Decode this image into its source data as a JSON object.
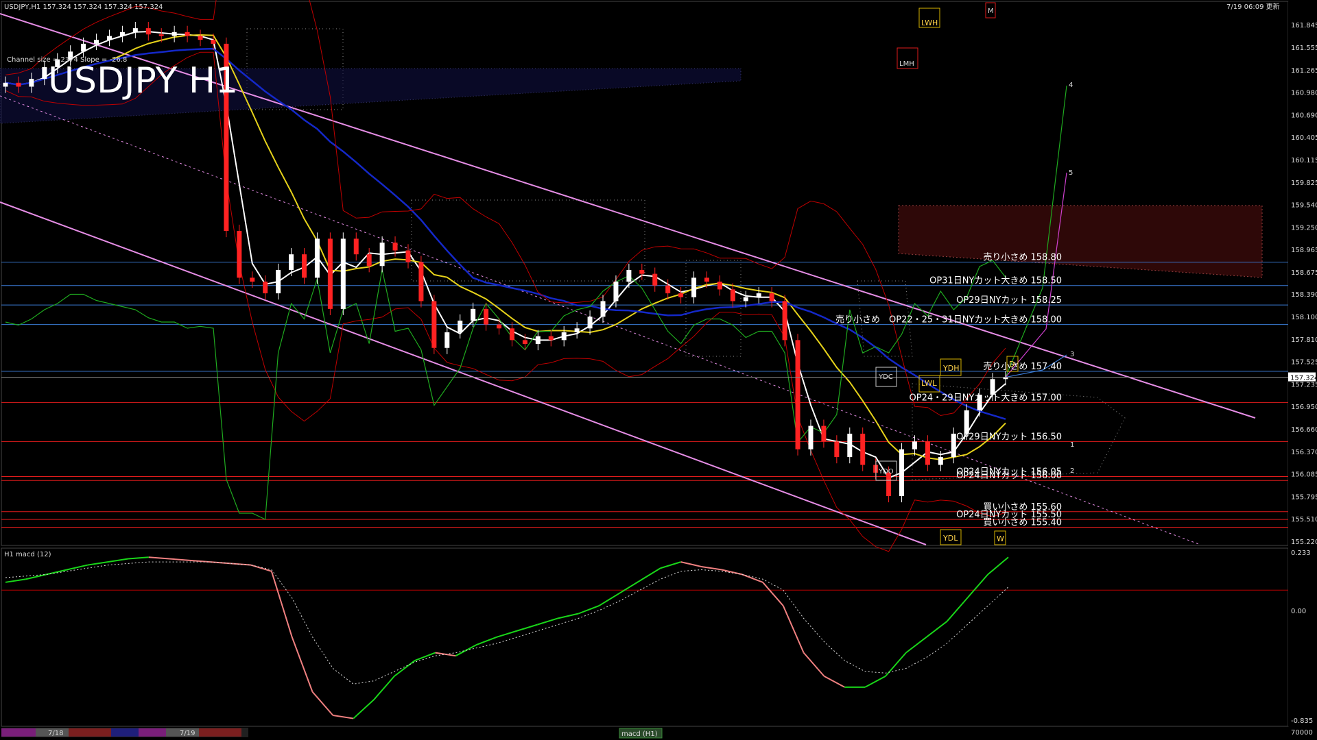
{
  "header": {
    "symbol_line": "USDJPY,H1  157.324 157.324 157.324 157.324",
    "timestamp": "7/19 06:09 更新",
    "channel_info": "Channel size = 2374 Slope = -26.8",
    "watermark": "USDJPY H1",
    "macd_label": "H1  macd (12)"
  },
  "price_axis": {
    "ticks": [
      "161.845",
      "161.555",
      "161.265",
      "160.980",
      "160.690",
      "160.405",
      "160.115",
      "159.825",
      "159.540",
      "159.250",
      "158.965",
      "158.675",
      "158.390",
      "158.100",
      "157.810",
      "157.525",
      "157.235",
      "156.950",
      "156.660",
      "156.370",
      "156.085",
      "155.795",
      "155.510",
      "155.220"
    ],
    "current": "157.324"
  },
  "macd_axis": {
    "ticks": [
      "0.233",
      "0.00",
      "-0.835",
      "70000"
    ]
  },
  "levels": [
    {
      "label": "売り小さめ 158.80",
      "price": 158.8,
      "color": "#3a7bd5"
    },
    {
      "label": "OP31日NYカット大きめ 158.50",
      "price": 158.5,
      "color": "#3a7bd5"
    },
    {
      "label": "OP29日NYカット 158.25",
      "price": 158.25,
      "color": "#3a7bd5"
    },
    {
      "label": "売り小さめ　OP22・25・31日NYカット大きめ 158.00",
      "price": 158.0,
      "color": "#3a7bd5"
    },
    {
      "label": "売り小さめ 157.40",
      "price": 157.4,
      "color": "#3a7bd5"
    },
    {
      "label": "OP24・29日NYカット大きめ 157.00",
      "price": 157.0,
      "color": "#e01b1b"
    },
    {
      "label": "OP29日NYカット 156.50",
      "price": 156.5,
      "color": "#e01b1b"
    },
    {
      "label": "OP24日NYカット 156.05",
      "price": 156.05,
      "color": "#e01b1b"
    },
    {
      "label": "OP24日NYカット 156.00",
      "price": 156.0,
      "color": "#e01b1b"
    },
    {
      "label": "買い小さめ 155.60",
      "price": 155.6,
      "color": "#e01b1b"
    },
    {
      "label": "OP24日NYカット 155.50",
      "price": 155.5,
      "color": "#e01b1b"
    },
    {
      "label": "買い小さめ 155.40",
      "price": 155.4,
      "color": "#e01b1b"
    }
  ],
  "markers": [
    "YDC",
    "YDH",
    "LWL",
    "YDO",
    "YDL",
    "LWH",
    "LMH",
    "M",
    "D",
    "W"
  ],
  "projection_labels": [
    "1",
    "2",
    "3",
    "4",
    "5"
  ],
  "bottom_bar": {
    "dates": [
      "7/18",
      "7/19"
    ],
    "tab": "macd (H1)"
  },
  "chart_data": {
    "type": "candlestick",
    "title": "USDJPY H1",
    "ylim": [
      155.22,
      161.845
    ],
    "close_path": [
      161.1,
      161.05,
      161.15,
      161.3,
      161.4,
      161.5,
      161.6,
      161.65,
      161.7,
      161.75,
      161.8,
      161.72,
      161.7,
      161.75,
      161.7,
      161.65,
      161.6,
      159.2,
      158.6,
      158.55,
      158.4,
      158.7,
      158.9,
      158.6,
      159.1,
      158.2,
      159.1,
      158.9,
      158.75,
      159.05,
      158.95,
      158.8,
      158.3,
      157.7,
      157.9,
      158.05,
      158.2,
      158.0,
      157.95,
      157.8,
      157.75,
      157.85,
      157.8,
      157.9,
      157.95,
      158.1,
      158.3,
      158.55,
      158.7,
      158.65,
      158.5,
      158.4,
      158.35,
      158.6,
      158.55,
      158.45,
      158.3,
      158.35,
      158.4,
      158.3,
      157.8,
      156.4,
      156.7,
      156.5,
      156.3,
      156.6,
      156.2,
      156.1,
      155.8,
      156.4,
      156.5,
      156.2,
      156.3,
      156.6,
      156.9,
      157.1,
      157.3,
      157.324
    ],
    "macd": [
      0.05,
      0.07,
      0.1,
      0.13,
      0.16,
      0.18,
      0.2,
      0.21,
      0.2,
      0.19,
      0.18,
      0.17,
      0.16,
      0.12,
      -0.3,
      -0.65,
      -0.8,
      -0.82,
      -0.7,
      -0.55,
      -0.45,
      -0.4,
      -0.42,
      -0.35,
      -0.3,
      -0.26,
      -0.22,
      -0.18,
      -0.15,
      -0.1,
      -0.02,
      0.06,
      0.14,
      0.18,
      0.15,
      0.13,
      0.1,
      0.05,
      -0.1,
      -0.4,
      -0.55,
      -0.62,
      -0.62,
      -0.55,
      -0.4,
      -0.3,
      -0.2,
      -0.05,
      0.1,
      0.21
    ],
    "signal": [
      0.08,
      0.09,
      0.1,
      0.12,
      0.14,
      0.16,
      0.17,
      0.18,
      0.18,
      0.18,
      0.18,
      0.17,
      0.16,
      0.13,
      -0.05,
      -0.3,
      -0.5,
      -0.6,
      -0.58,
      -0.52,
      -0.46,
      -0.42,
      -0.4,
      -0.37,
      -0.34,
      -0.3,
      -0.26,
      -0.22,
      -0.18,
      -0.13,
      -0.07,
      0.0,
      0.07,
      0.12,
      0.13,
      0.12,
      0.1,
      0.07,
      0.0,
      -0.18,
      -0.33,
      -0.45,
      -0.52,
      -0.53,
      -0.5,
      -0.43,
      -0.34,
      -0.22,
      -0.1,
      0.02
    ],
    "macd_ylim": [
      -0.835,
      0.233
    ]
  },
  "colors": {
    "bull": "#ffffff",
    "bear": "#ff2222",
    "ma_white": "#ffffff",
    "ma_yellow": "#e6d21a",
    "ma_blue": "#1428c8",
    "bollinger": "#c00000",
    "channel": "#e58de5",
    "rsi": "#1faa1f",
    "cloud": "#c8c8c8",
    "macd_up": "#19d619",
    "macd_down": "#f08080"
  }
}
